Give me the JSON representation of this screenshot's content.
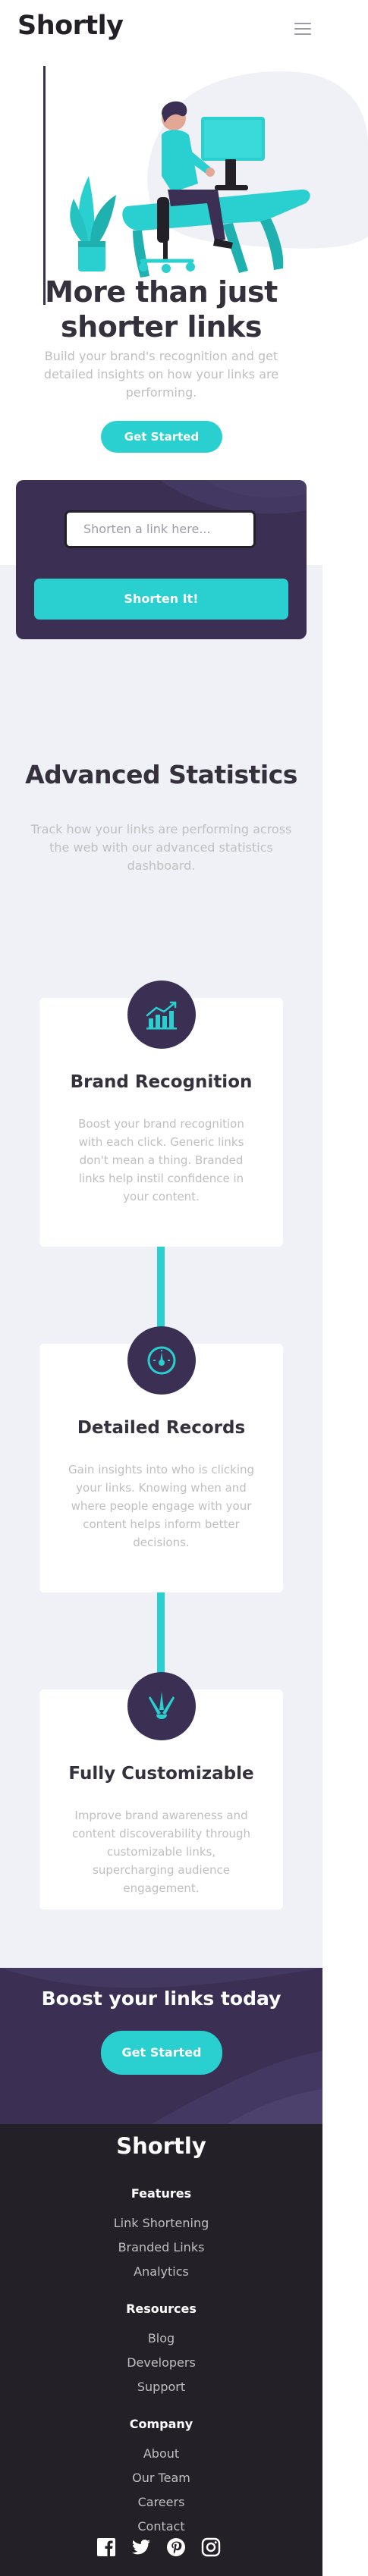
{
  "header": {
    "logo": "Shortly",
    "menu_icon": "hamburger-menu-icon"
  },
  "hero": {
    "illustration": "person-working-at-desk-illustration",
    "title": "More than just shorter links",
    "text": "Build your brand's recognition and get detailed insights on how your links are performing.",
    "cta_label": "Get Started"
  },
  "shorten": {
    "placeholder": "Shorten a link here...",
    "button_label": "Shorten It!"
  },
  "statistics": {
    "title": "Advanced Statistics",
    "text": "Track how your links are performing across the web with our advanced statistics dashboard.",
    "cards": [
      {
        "title": "Brand Recognition",
        "text": "Boost your brand recognition with each click. Generic links don't mean a thing. Branded links help instil confidence in your content.",
        "icon": "bar-chart-icon"
      },
      {
        "title": "Detailed Records",
        "text": "Gain insights into who is clicking your links. Knowing when and where people engage with your content helps inform better decisions.",
        "icon": "gauge-icon"
      },
      {
        "title": "Fully Customizable",
        "text": "Improve brand awareness and content discoverability through customizable links, supercharging audience engagement.",
        "icon": "brushes-icon"
      }
    ]
  },
  "boost": {
    "title": "Boost your links today",
    "cta_label": "Get Started"
  },
  "footer": {
    "logo": "Shortly",
    "features": {
      "heading": "Features",
      "links": [
        "Link Shortening",
        "Branded Links",
        "Analytics"
      ]
    },
    "resources": {
      "heading": "Resources",
      "links": [
        "Blog",
        "Developers",
        "Support"
      ]
    },
    "company": {
      "heading": "Company",
      "links": [
        "About",
        "Our Team",
        "Careers",
        "Contact"
      ]
    },
    "social": [
      "facebook-icon",
      "twitter-icon",
      "pinterest-icon",
      "instagram-icon"
    ]
  },
  "colors": {
    "cyan": "#2acfcf",
    "dark_violet": "#3b3054",
    "very_dark_violet": "#232127",
    "gray": "#bfbfbf",
    "light_bg": "#f0f1f6"
  }
}
